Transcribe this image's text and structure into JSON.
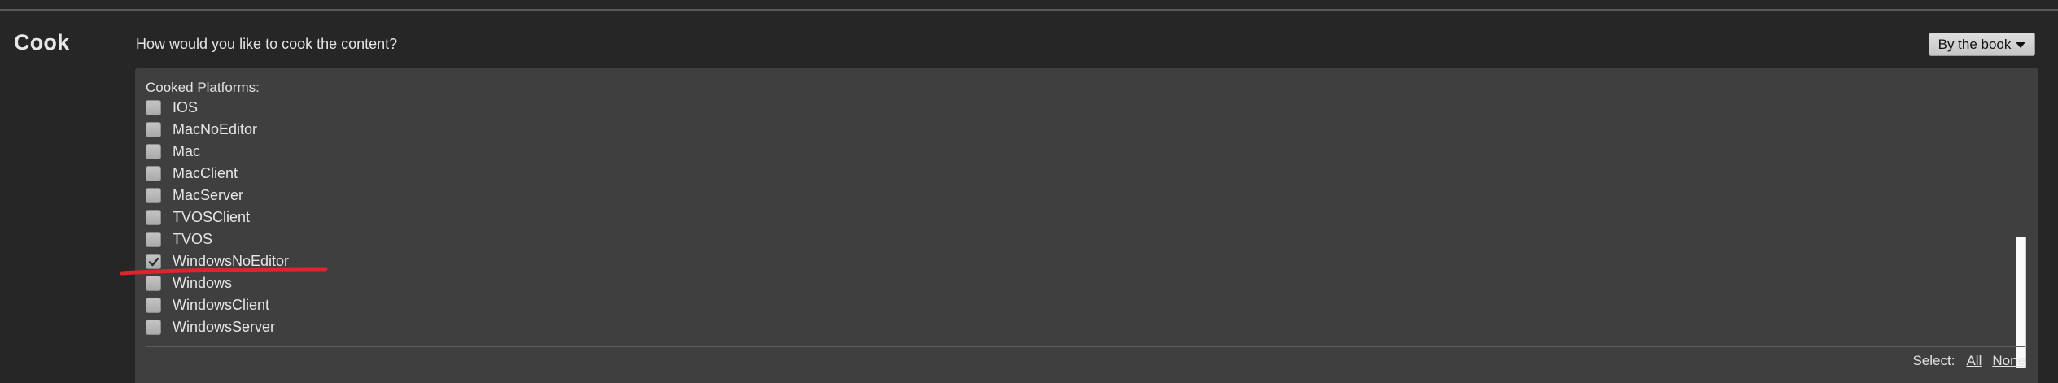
{
  "section": {
    "title": "Cook"
  },
  "cook_mode": {
    "question": "How would you like to cook the content?",
    "selected": "By the book"
  },
  "platforms": {
    "label": "Cooked Platforms:",
    "items": [
      {
        "label": "IOS",
        "checked": false
      },
      {
        "label": "MacNoEditor",
        "checked": false
      },
      {
        "label": "Mac",
        "checked": false
      },
      {
        "label": "MacClient",
        "checked": false
      },
      {
        "label": "MacServer",
        "checked": false
      },
      {
        "label": "TVOSClient",
        "checked": false
      },
      {
        "label": "TVOS",
        "checked": false
      },
      {
        "label": "WindowsNoEditor",
        "checked": true
      },
      {
        "label": "Windows",
        "checked": false
      },
      {
        "label": "WindowsClient",
        "checked": false
      },
      {
        "label": "WindowsServer",
        "checked": false
      }
    ]
  },
  "selection": {
    "label": "Select:",
    "all": "All",
    "none": "None"
  },
  "annotation_color": "#e0232d",
  "icons": {
    "checkbox_checked": "check-icon",
    "dropdown_caret": "caret-down-icon"
  }
}
